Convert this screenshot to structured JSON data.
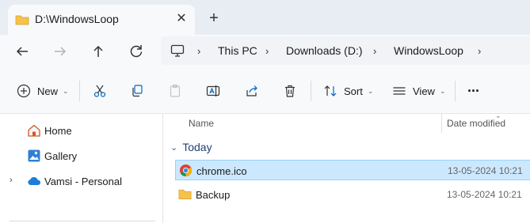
{
  "tab": {
    "title": "D:\\WindowsLoop",
    "close": "✕",
    "new": "+"
  },
  "breadcrumb": [
    "This PC",
    "Downloads (D:)",
    "WindowsLoop"
  ],
  "toolbar": {
    "new_label": "New",
    "sort_label": "Sort",
    "view_label": "View",
    "more": "···"
  },
  "sidebar": {
    "items": [
      {
        "label": "Home",
        "icon": "home-icon"
      },
      {
        "label": "Gallery",
        "icon": "gallery-icon"
      },
      {
        "label": "Vamsi - Personal",
        "icon": "onedrive-cloud-icon"
      }
    ]
  },
  "list": {
    "columns": [
      "Name",
      "Date modified"
    ],
    "group": "Today",
    "rows": [
      {
        "name": "chrome.ico",
        "date": "13-05-2024 10:21",
        "icon": "chrome-icon",
        "selected": true
      },
      {
        "name": "Backup",
        "date": "13-05-2024 10:21",
        "icon": "folder-icon",
        "selected": false
      }
    ]
  },
  "colors": {
    "selection": "#cce8ff",
    "accent": "#0067c0",
    "folder": "#f5c24c"
  }
}
